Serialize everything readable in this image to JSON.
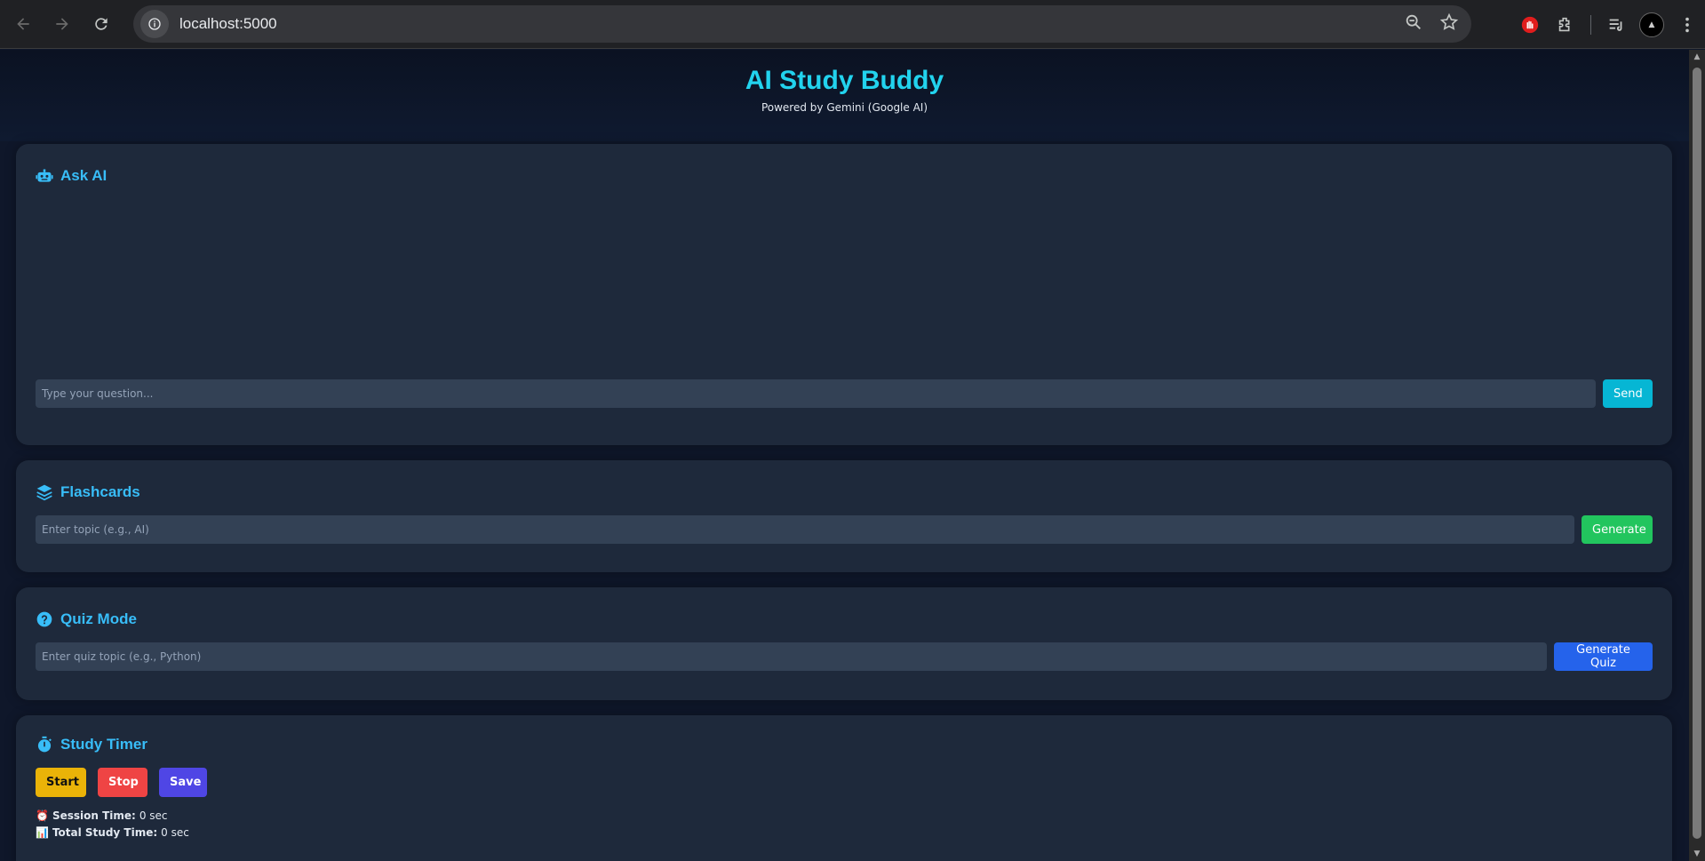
{
  "browser": {
    "url": "localhost:5000"
  },
  "header": {
    "title": "AI Study Buddy",
    "subtitle": "Powered by Gemini (Google AI)"
  },
  "ask_ai": {
    "title": "Ask AI",
    "placeholder": "Type your question...",
    "send_label": "Send"
  },
  "flashcards": {
    "title": "Flashcards",
    "placeholder": "Enter topic (e.g., AI)",
    "generate_label": "Generate"
  },
  "quiz": {
    "title": "Quiz Mode",
    "placeholder": "Enter quiz topic (e.g., Python)",
    "generate_label": "Generate Quiz"
  },
  "timer": {
    "title": "Study Timer",
    "start_label": "Start",
    "stop_label": "Stop",
    "save_label": "Save",
    "session_icon": "⏰",
    "session_label": "Session Time:",
    "session_value": "0 sec",
    "total_icon": "📊",
    "total_label": "Total Study Time:",
    "total_value": "0 sec"
  },
  "colors": {
    "accent": "#22d3ee",
    "heading": "#38bdf8",
    "send": "#06b6d4",
    "generate": "#22c55e",
    "quiz": "#2563eb",
    "start": "#eab308",
    "stop": "#ef4444",
    "save": "#4f46e5"
  }
}
